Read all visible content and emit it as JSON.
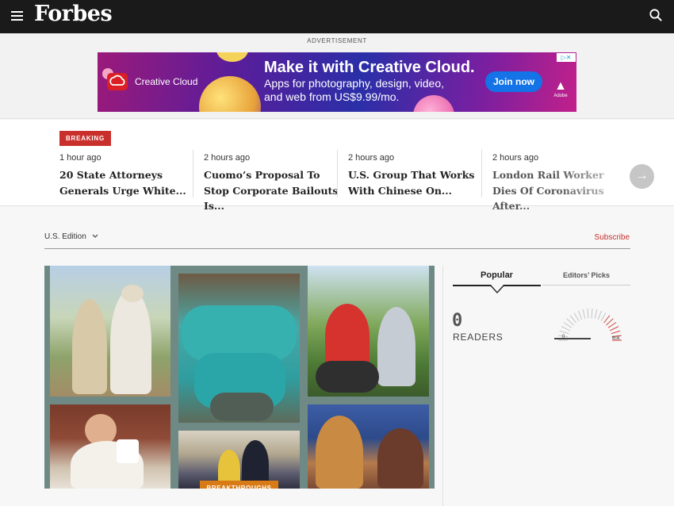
{
  "header": {
    "logo_text": "Forbes",
    "menu_icon": "hamburger-menu-icon",
    "search_icon": "search-icon"
  },
  "ad": {
    "label": "ADVERTISEMENT",
    "brand": "Creative Cloud",
    "headline": "Make it with Creative Cloud.",
    "subtext": "Apps for photography, design, video, and web from US$9.99/mo.",
    "cta": "Join now",
    "sponsor": "Adobe",
    "choices_icon": "ad-choices-icon"
  },
  "breaking": {
    "badge": "BREAKING",
    "stories": [
      {
        "time": "1 hour ago",
        "headline": "20 State Attorneys Generals Urge White..."
      },
      {
        "time": "2 hours ago",
        "headline": "Cuomo’s Proposal To Stop Corporate Bailouts Is..."
      },
      {
        "time": "2 hours ago",
        "headline": "U.S. Group That Works With Chinese On..."
      },
      {
        "time": "2 hours ago",
        "headline": "London Rail Worker Dies Of Coronavirus After..."
      }
    ],
    "next_icon": "arrow-right-icon"
  },
  "edition": {
    "label": "U.S. Edition",
    "dropdown_icon": "chevron-down-icon",
    "subscribe": "Subscribe"
  },
  "feature": {
    "tag": "BREAKTHROUGHS"
  },
  "sidebar": {
    "tabs": [
      {
        "label": "Popular",
        "active": true
      },
      {
        "label": "Editors’ Picks",
        "active": false
      }
    ],
    "readers_count": "0",
    "readers_label": "READERS",
    "gauge": {
      "min_label": "0",
      "max_label": "60k",
      "value": 0
    }
  },
  "colors": {
    "header_bg": "#1a1a1a",
    "accent_red": "#c9302c",
    "tag_orange": "#d87a15"
  }
}
